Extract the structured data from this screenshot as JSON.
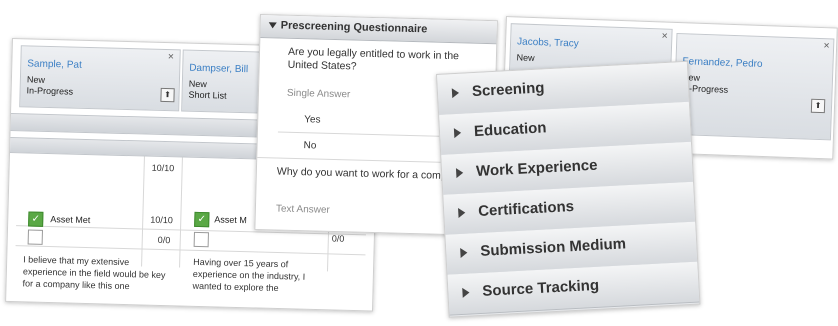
{
  "left_cards": [
    {
      "name": "Sample, Pat",
      "line1": "New",
      "line2": "In-Progress"
    },
    {
      "name": "Dampser, Bill",
      "line1": "New",
      "line2": "Short List"
    }
  ],
  "left_scores": [
    "10/10",
    "10/10",
    "0/0",
    "0/0"
  ],
  "left_checks": [
    {
      "label": "Asset Met"
    },
    {
      "label": "Asset M"
    }
  ],
  "left_notes": [
    "I believe that my extensive experience in the field would be key for a company like this one",
    "Having over 15 years of experience on the industry, I wanted to explore the"
  ],
  "questionnaire": {
    "title": "Prescreening Questionnaire",
    "q1": "Are you legally entitled to work in the United States?",
    "q1_type": "Single Answer",
    "options": [
      "Yes",
      "No"
    ],
    "q2": "Why do you want to work for a company?",
    "q2_type": "Text Answer"
  },
  "right_cards": [
    {
      "name": "Jacobs, Tracy",
      "line1": "New",
      "line2": ""
    },
    {
      "name": "Fernandez, Pedro",
      "line1": "New",
      "line2": "In-Progress"
    }
  ],
  "accordion": [
    "Screening",
    "Education",
    "Work Experience",
    "Certifications",
    "Submission Medium",
    "Source Tracking"
  ]
}
